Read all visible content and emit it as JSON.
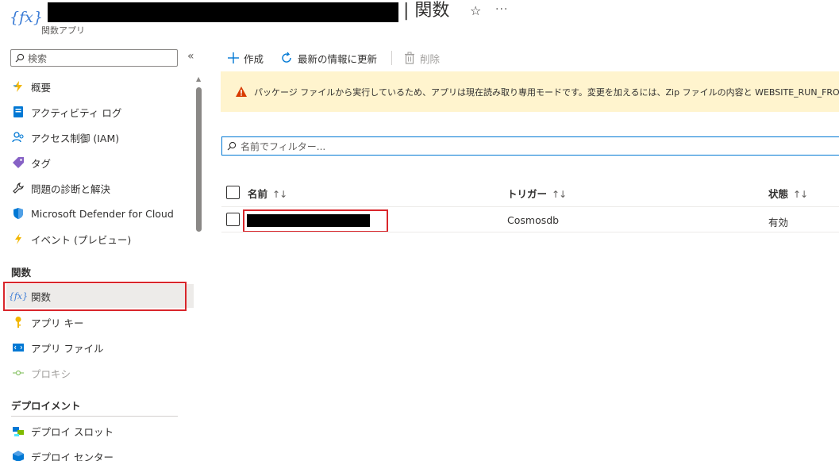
{
  "header": {
    "icon_text": "{fx}",
    "title": "| 関数",
    "subtitle": "関数アプリ",
    "star_icon": "☆",
    "more_icon": "···"
  },
  "sidebar": {
    "search_placeholder": "検索",
    "collapse_icon": "«",
    "items": [
      {
        "label": "概要",
        "icon": "overview-icon"
      },
      {
        "label": "アクティビティ ログ",
        "icon": "activity-log-icon"
      },
      {
        "label": "アクセス制御 (IAM)",
        "icon": "iam-icon"
      },
      {
        "label": "タグ",
        "icon": "tag-icon"
      },
      {
        "label": "問題の診断と解決",
        "icon": "wrench-icon"
      },
      {
        "label": "Microsoft Defender for Cloud",
        "icon": "shield-icon"
      },
      {
        "label": "イベント (プレビュー)",
        "icon": "lightning-icon"
      }
    ],
    "section_functions": {
      "heading": "関数",
      "items": [
        {
          "label": "関数",
          "icon": "function-icon",
          "active": true
        },
        {
          "label": "アプリ キー",
          "icon": "key-icon"
        },
        {
          "label": "アプリ ファイル",
          "icon": "app-files-icon"
        },
        {
          "label": "プロキシ",
          "icon": "proxy-icon",
          "disabled": true
        }
      ]
    },
    "section_deploy": {
      "heading": "デプロイメント",
      "items": [
        {
          "label": "デプロイ スロット",
          "icon": "deploy-slot-icon"
        },
        {
          "label": "デプロイ センター",
          "icon": "deploy-center-icon"
        }
      ]
    }
  },
  "toolbar": {
    "create_label": "作成",
    "refresh_label": "最新の情報に更新",
    "delete_label": "削除"
  },
  "banner": {
    "text": "パッケージ ファイルから実行しているため、アプリは現在読み取り専用モードです。変更を加えるには、Zip ファイルの内容と WEBSITE_RUN_FROM_PACKAGE ア"
  },
  "filter": {
    "placeholder": "名前でフィルター..."
  },
  "table": {
    "columns": [
      {
        "label": "名前",
        "sort": "↑↓"
      },
      {
        "label": "トリガー",
        "sort": "↑↓"
      },
      {
        "label": "状態",
        "sort": "↑↓"
      }
    ],
    "rows": [
      {
        "name": "",
        "trigger": "Cosmosdb",
        "status": "有効"
      }
    ]
  },
  "colors": {
    "accent": "#0078d4",
    "highlight_border": "#d9262b",
    "warning_bg": "#fff4ce",
    "warning_icon": "#d83b01"
  }
}
